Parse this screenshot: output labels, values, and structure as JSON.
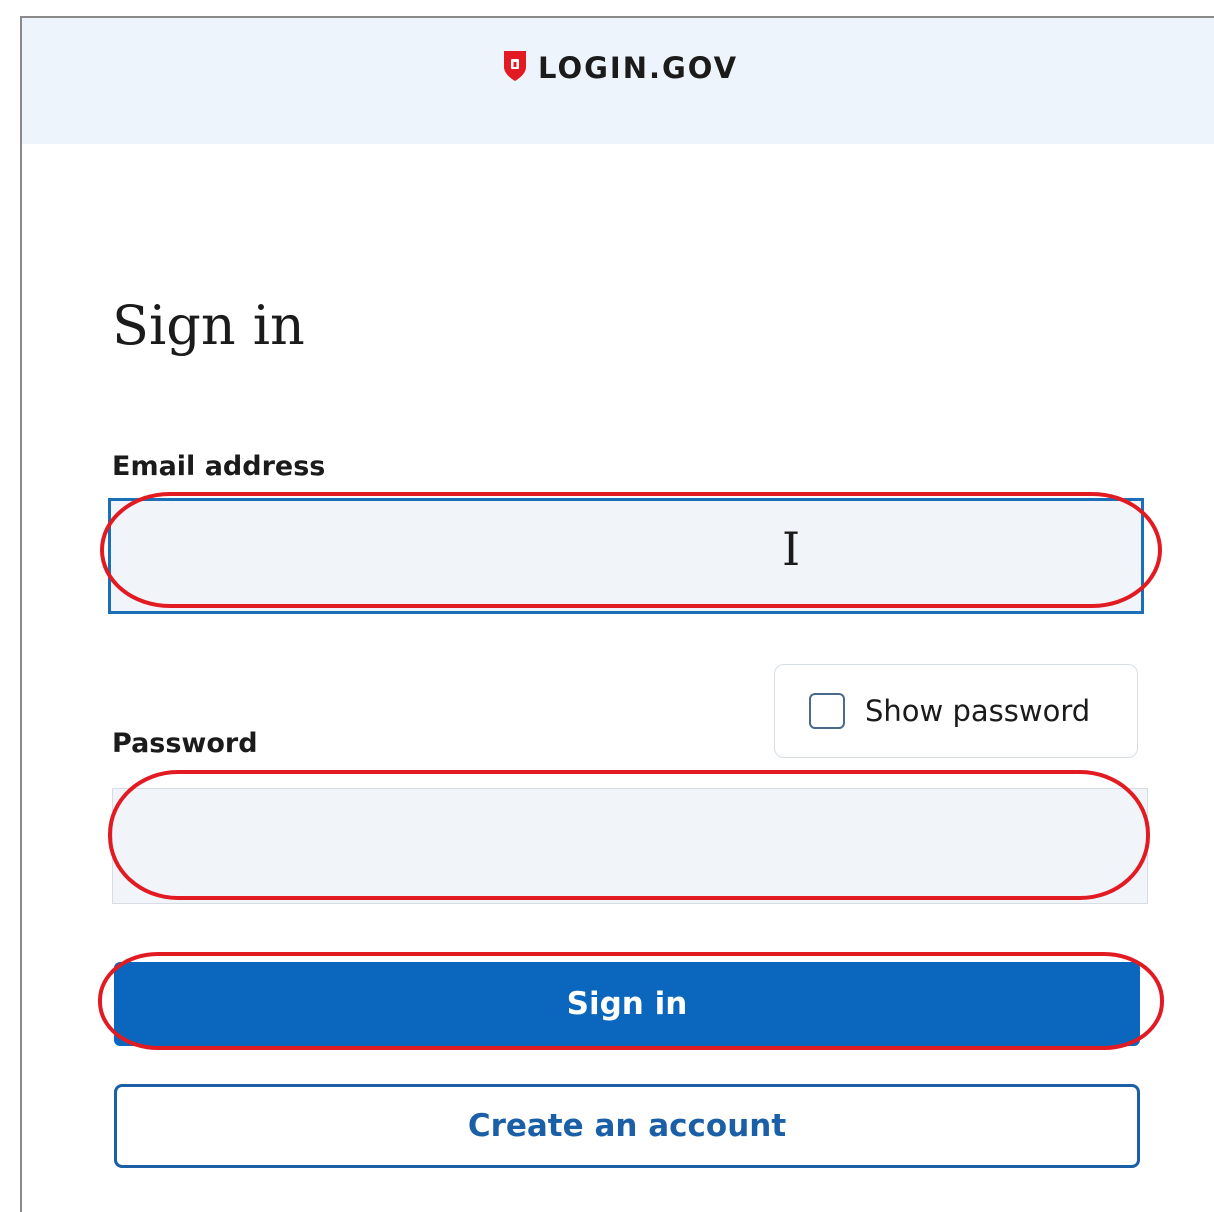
{
  "header": {
    "brand": "LOGIN.GOV",
    "logo_icon": "shield-lock-icon"
  },
  "page": {
    "title": "Sign in"
  },
  "form": {
    "email_label": "Email address",
    "email_value": "",
    "password_label": "Password",
    "password_value": "",
    "show_password_label": "Show password",
    "show_password_checked": false,
    "sign_in_label": "Sign in",
    "create_account_label": "Create an account"
  },
  "colors": {
    "header_bg": "#eef4fb",
    "primary": "#0a67bd",
    "highlight": "#e21b23"
  }
}
